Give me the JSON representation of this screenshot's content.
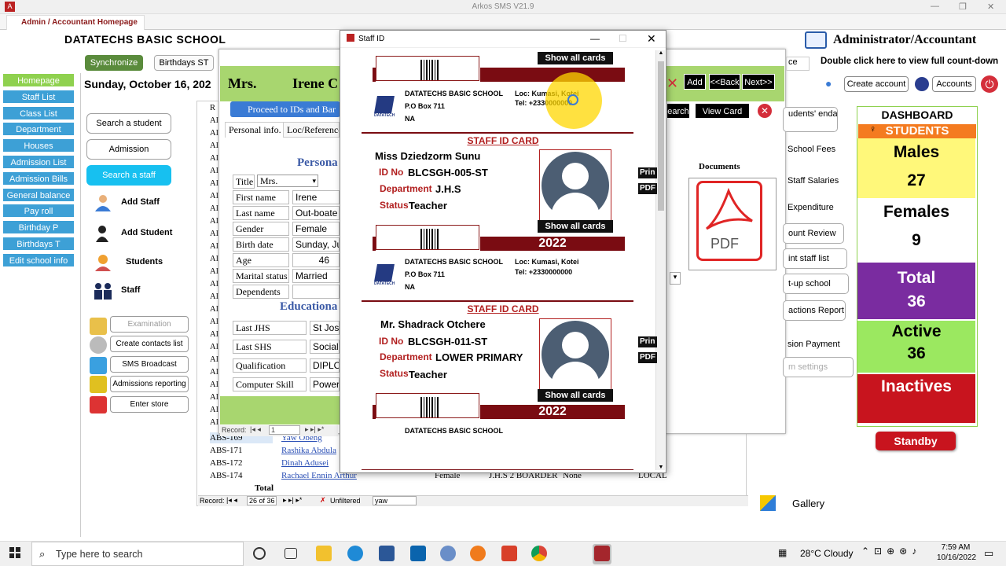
{
  "window": {
    "app_title": "Arkos SMS V21.9",
    "tab": "Admin / Accountant Homepage"
  },
  "school": {
    "name": "DATATECHS BASIC SCHOOL"
  },
  "top": {
    "sync": "Synchronize",
    "birthdays": "Birthdays ST",
    "date": "Sunday, October 16, 202"
  },
  "leftnav": [
    "Homepage",
    "Staff List",
    "Class List",
    "Department",
    "Houses",
    "Admission List",
    "Admission Bills",
    "General balance",
    "Pay roll",
    "Birthday P",
    "Birthdays T",
    "Edit school info"
  ],
  "actions": {
    "search_student": "Search a student",
    "admission": "Admission",
    "search_staff": "Search a staff",
    "add_staff": "Add Staff",
    "add_student": "Add Student",
    "students": "Students",
    "staff": "Staff"
  },
  "tools": {
    "exam": "Examination",
    "contacts": "Create contacts list",
    "sms": "SMS Broadcast",
    "admrep": "Admissions reporting",
    "store": "Enter store"
  },
  "bgform": {
    "mrs": "Mrs.",
    "irene": "Irene  C",
    "proceed": "Proceed to IDs and Bar",
    "tab1": "Personal info.",
    "tab2": "Loc/Reference",
    "persona": "Persona",
    "educ": "Educationa",
    "title_lab": "Title",
    "title_val": "Mrs.",
    "fields": [
      {
        "l": "First name",
        "v": "Irene"
      },
      {
        "l": "Last name",
        "v": "Out-boate"
      },
      {
        "l": "Gender",
        "v": "Female"
      },
      {
        "l": "Birth date",
        "v": "Sunday, Ju"
      },
      {
        "l": "Age",
        "v": "46"
      },
      {
        "l": "Marital status",
        "v": "Married"
      },
      {
        "l": "Dependents",
        "v": ""
      }
    ],
    "edu": [
      {
        "l": "Last JHS",
        "v": "St Jose"
      },
      {
        "l": "Last SHS",
        "v": "Social"
      },
      {
        "l": "Qualification",
        "v": "DIPLOM"
      },
      {
        "l": "Computer Skill",
        "v": "Powerp"
      }
    ],
    "record_label": "Record:",
    "record_val": "1"
  },
  "table": {
    "row_ids_partial": [
      "R",
      "AI",
      "AI",
      "AI",
      "AI",
      "AI",
      "AI",
      "AI",
      "AI",
      "AI",
      "AI",
      "AI",
      "AI",
      "AI",
      "AI",
      "AI",
      "AI",
      "AI",
      "AI",
      "AI",
      "AI",
      "AI",
      "AI",
      "AI",
      "AI",
      "AI"
    ],
    "rows": [
      {
        "id": "ABS-169",
        "name": "Yaw Obeng",
        "gender": "",
        "class": "",
        "status": "",
        "loc": ""
      },
      {
        "id": "ABS-171",
        "name": "Rashika Abdula",
        "gender": "",
        "class": "",
        "status": "",
        "loc": ""
      },
      {
        "id": "ABS-172",
        "name": "Dinah Adusei",
        "gender": "",
        "class": "",
        "status": "",
        "loc": ""
      },
      {
        "id": "ABS-174",
        "name": "Rachael Ennin Arthur",
        "gender": "Female",
        "class": "J.H.S 2 BOARDER",
        "status": "None",
        "loc": "LOCAL"
      }
    ],
    "total": "Total",
    "record_label": "Record:",
    "record_pos": "26 of 36",
    "filter": "Unfiltered",
    "search": "yaw"
  },
  "idwin": {
    "title": "Staff ID",
    "show_all": "Show all cards",
    "year": "2022",
    "school": "DATATECHS BASIC SCHOOL",
    "pobox": "P.O Box 711",
    "na": "NA",
    "loc": "Loc: Kumasi, Kotei",
    "tel": "Tel:  +2330000000",
    "staff_id_card": "STAFF ID CARD",
    "lab_id": "ID No",
    "lab_dept": "Department",
    "lab_status": "Status",
    "logo_txt": "DATATECH",
    "card1": {
      "name": "Miss Dziedzorm  Sunu",
      "id": "BLCSGH-005-ST",
      "dept": "J.H.S",
      "status": "Teacher"
    },
    "card2": {
      "name": "Mr. Shadrack  Otchere",
      "id": "BLCSGH-011-ST",
      "dept": "LOWER PRIMARY",
      "status": "Teacher"
    },
    "prin": "Prin",
    "pdf": "PDF"
  },
  "right": {
    "admin": "Administrator/Accountant",
    "ce": "ce",
    "dblclick": "Double click here to view full count-down",
    "add": "Add",
    "back": "<<Back",
    "next": "Next>>",
    "search": "earch",
    "viewcard": "View Card",
    "create_account": "Create account",
    "accounts": "Accounts",
    "students_att": "udents' endance",
    "fees": "School Fees",
    "salaries": "Staff Salaries",
    "expend": "Expenditure",
    "countreview": "ount Review",
    "printstaff": "int staff list",
    "setup": "t-up school",
    "transrep": "actions Report",
    "admpay": "sion Payment",
    "settings": "m settings",
    "documents": "Documents",
    "pdf": "PDF"
  },
  "dashboard": {
    "title": "DASHBOARD",
    "students": "STUDENTS",
    "males_lab": "Males",
    "males": "27",
    "females_lab": "Females",
    "females": "9",
    "total_lab": "Total",
    "total": "36",
    "active_lab": "Active",
    "active": "36",
    "inactive_lab": "Inactives",
    "standby": "Standby"
  },
  "gallery": "Gallery",
  "taskbar": {
    "search": "Type here to search",
    "weather": "28°C  Cloudy",
    "time": "7:59 AM",
    "date": "10/16/2022"
  },
  "colors": {
    "nav": "#3da0d6",
    "nav_active": "#8fd14f",
    "card_red": "#7a0c12",
    "females": "#ffffff",
    "total": "#7a2ca0",
    "inactive": "#c8141e"
  }
}
